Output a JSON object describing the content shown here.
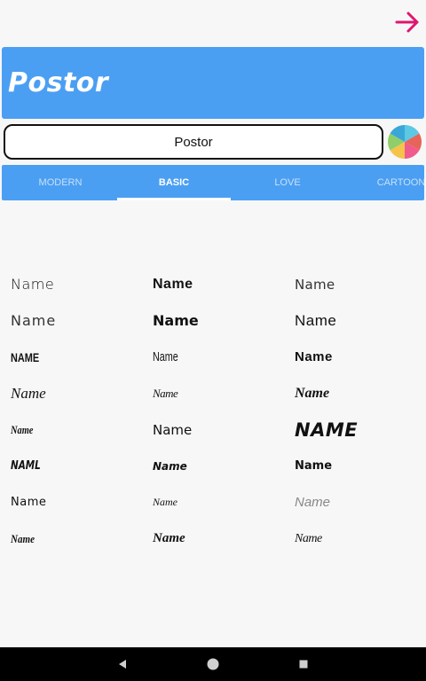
{
  "app": {
    "title": "Postor",
    "accent": "#4b9ff2",
    "next_icon_color": "#e0156f"
  },
  "input": {
    "value": "Postor"
  },
  "tabs": [
    {
      "label": "MODERN"
    },
    {
      "label": "BASIC",
      "selected": true
    },
    {
      "label": "LOVE"
    },
    {
      "label": "CARTOON"
    }
  ],
  "fonts": [
    [
      "Name",
      "Name",
      "Name"
    ],
    [
      "Name",
      "Name",
      "Name"
    ],
    [
      "NAME",
      "Name",
      "Name"
    ],
    [
      "Name",
      "Name",
      "Name"
    ],
    [
      "Name",
      "Name",
      "NAME"
    ],
    [
      "NAML",
      "Name",
      "Name"
    ],
    [
      "Name",
      "Name",
      "Name"
    ],
    [
      "Name",
      "Name",
      "Name"
    ]
  ],
  "icons": {
    "next": "arrow-right-icon",
    "color_picker": "color-wheel-icon",
    "back": "back-triangle-icon",
    "home": "home-circle-icon",
    "recents": "recents-square-icon"
  }
}
